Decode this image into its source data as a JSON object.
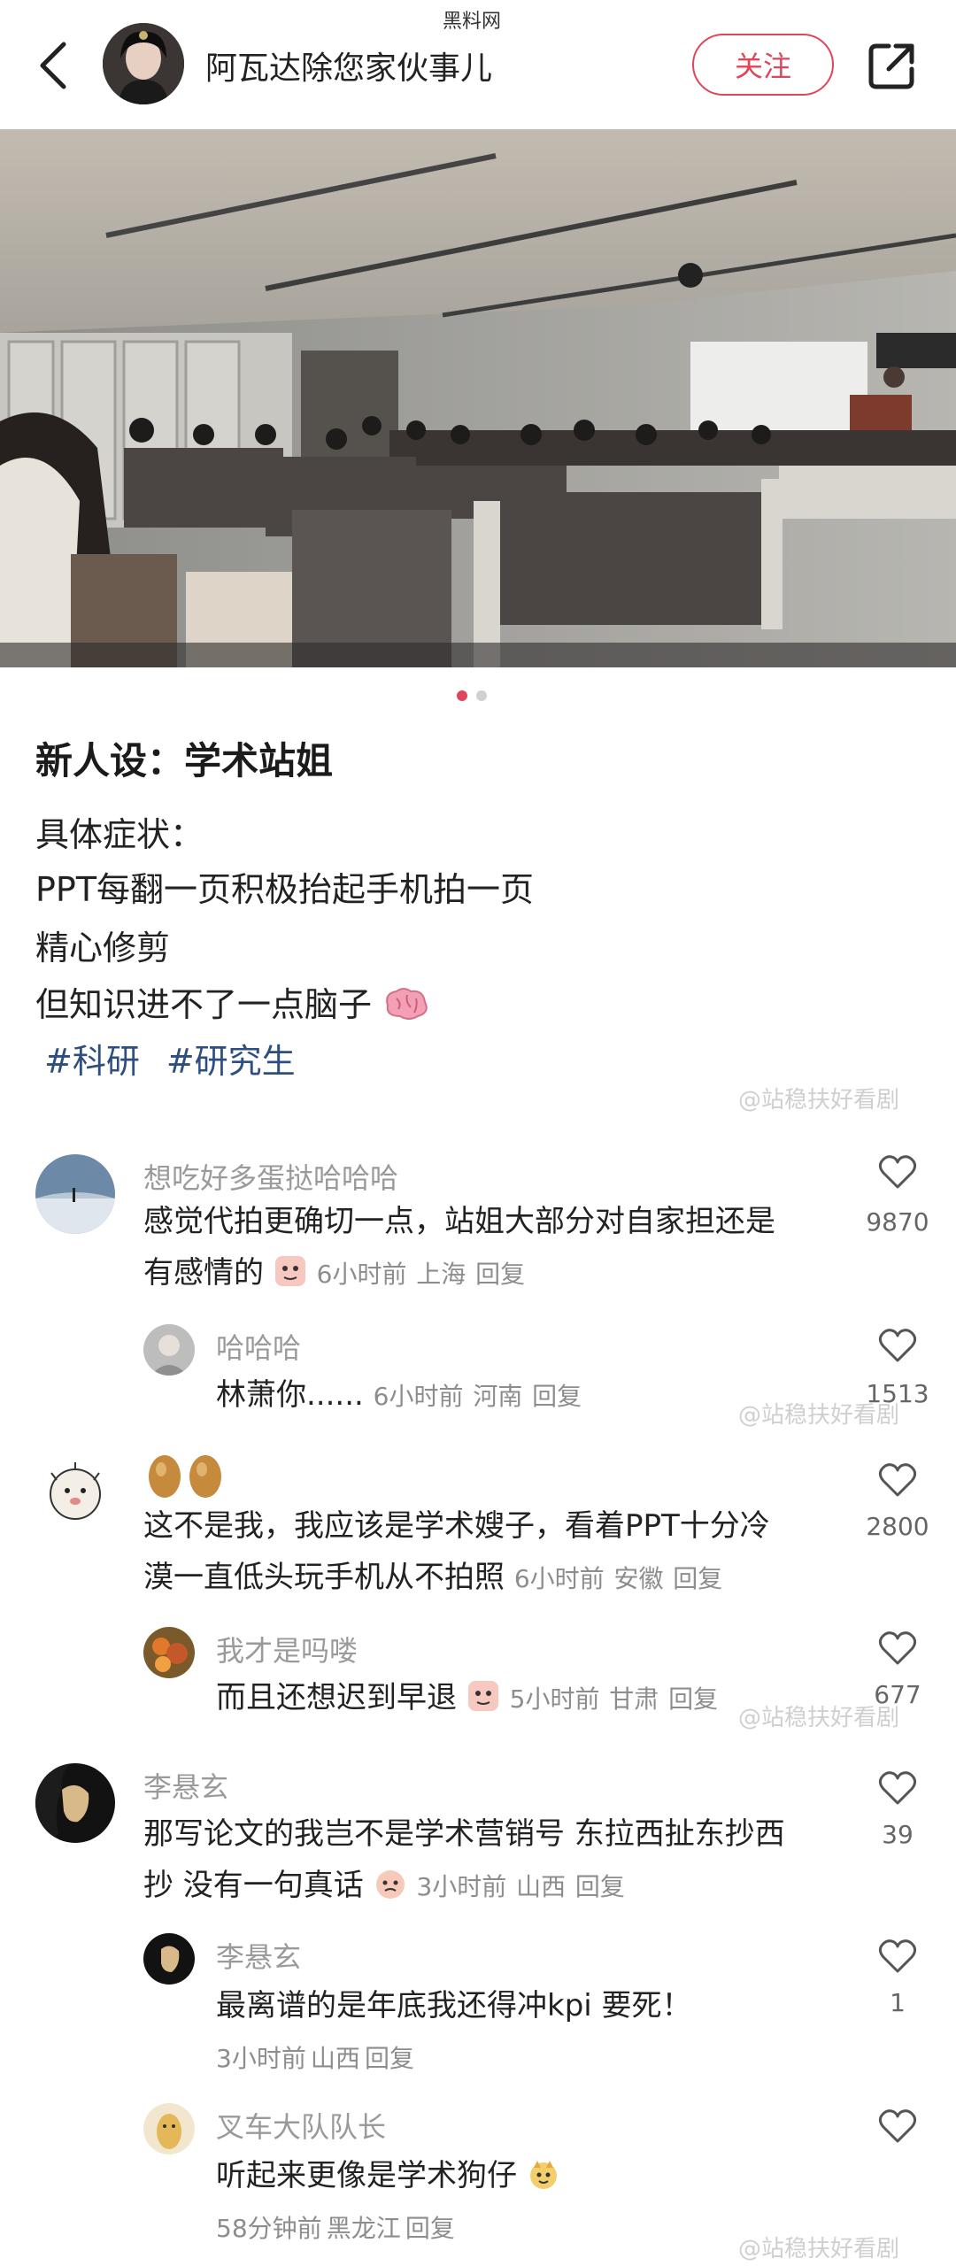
{
  "watermark_site": "黑料网",
  "header": {
    "author_name": "阿瓦达除您家伙事儿",
    "follow_label": "关注"
  },
  "post": {
    "title": "新人设：学术站姐",
    "lines": [
      "具体症状：",
      "PPT每翻一页积极抬起手机拍一页",
      "精心修剪",
      "但知识进不了一点脑子"
    ],
    "tags": [
      "#科研",
      "#研究生"
    ]
  },
  "watermark_text": "@站稳扶好看剧",
  "comments": [
    {
      "user": "想吃好多蛋挞哈哈哈",
      "text1": "感觉代拍更确切一点，站姐大部分对自家担还是",
      "text2": "有感情的",
      "time": "6小时前",
      "location": "上海",
      "reply": "回复",
      "likes": "9870"
    },
    {
      "user": "哈哈哈",
      "text1": "林萧你......",
      "time": "6小时前",
      "location": "河南",
      "reply": "回复",
      "likes": "1513"
    },
    {
      "user": "",
      "text1": "这不是我，我应该是学术嫂子，看着PPT十分冷",
      "text2": "漠一直低头玩手机从不拍照",
      "time": "6小时前",
      "location": "安徽",
      "reply": "回复",
      "likes": "2800"
    },
    {
      "user": "我才是吗喽",
      "text1": "而且还想迟到早退",
      "time": "5小时前",
      "location": "甘肃",
      "reply": "回复",
      "likes": "677"
    },
    {
      "user": "李悬玄",
      "text1": "那写论文的我岂不是学术营销号 东拉西扯东抄西",
      "text2": "抄 没有一句真话",
      "time": "3小时前",
      "location": "山西",
      "reply": "回复",
      "likes": "39"
    },
    {
      "user": "李悬玄",
      "text1": "最离谱的是年底我还得冲kpi 要死！",
      "time": "3小时前",
      "location": "山西",
      "reply": "回复",
      "likes": "1"
    },
    {
      "user": "叉车大队队长",
      "text1": "听起来更像是学术狗仔",
      "time": "58分钟前",
      "location": "黑龙江",
      "reply": "回复",
      "likes": ""
    }
  ],
  "icons": {
    "back": "chevron-left-icon",
    "share": "share-icon",
    "heart": "heart-outline-icon"
  },
  "colors": {
    "accent": "#e0455a",
    "tag": "#2d4e7e"
  }
}
